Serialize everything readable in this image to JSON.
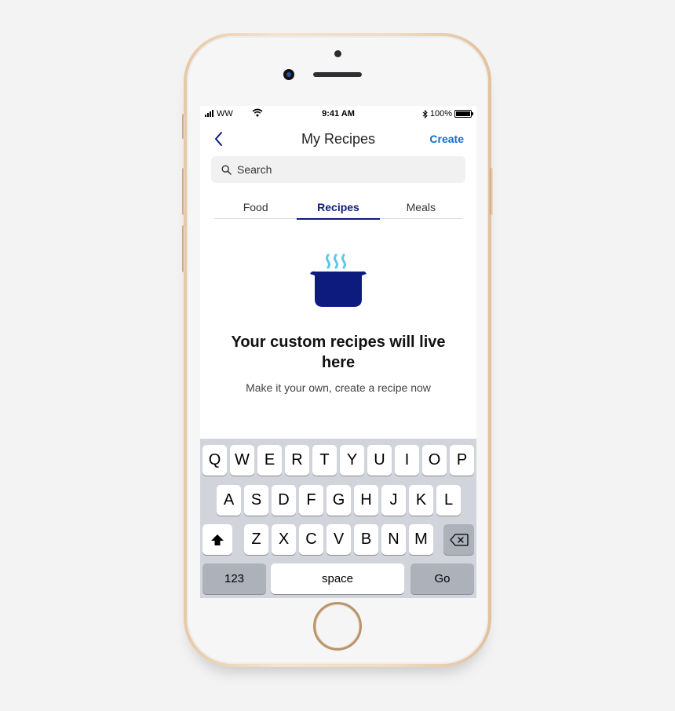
{
  "status_bar": {
    "carrier": "WW",
    "time": "9:41 AM",
    "battery": "100%"
  },
  "nav": {
    "back_icon": "chevron-left-icon",
    "title": "My Recipes",
    "create_label": "Create"
  },
  "search": {
    "icon": "search-icon",
    "placeholder": "Search",
    "value": ""
  },
  "tabs": [
    {
      "label": "Food",
      "active": false
    },
    {
      "label": "Recipes",
      "active": true
    },
    {
      "label": "Meals",
      "active": false
    }
  ],
  "empty_state": {
    "icon": "cooking-pot-icon",
    "title": "Your custom recipes will live here",
    "subtitle": "Make it your own, create a recipe now"
  },
  "keyboard": {
    "row1": [
      "Q",
      "W",
      "E",
      "R",
      "T",
      "Y",
      "U",
      "I",
      "O",
      "P"
    ],
    "row2": [
      "A",
      "S",
      "D",
      "F",
      "G",
      "H",
      "J",
      "K",
      "L"
    ],
    "row3": [
      "Z",
      "X",
      "C",
      "V",
      "B",
      "N",
      "M"
    ],
    "shift_icon": "shift-icon",
    "delete_icon": "backspace-icon",
    "numbers_label": "123",
    "space_label": "space",
    "go_label": "Go"
  },
  "colors": {
    "accent_blue": "#0f6fd6",
    "navy": "#0c1b7d",
    "steam": "#5bc8ec"
  }
}
